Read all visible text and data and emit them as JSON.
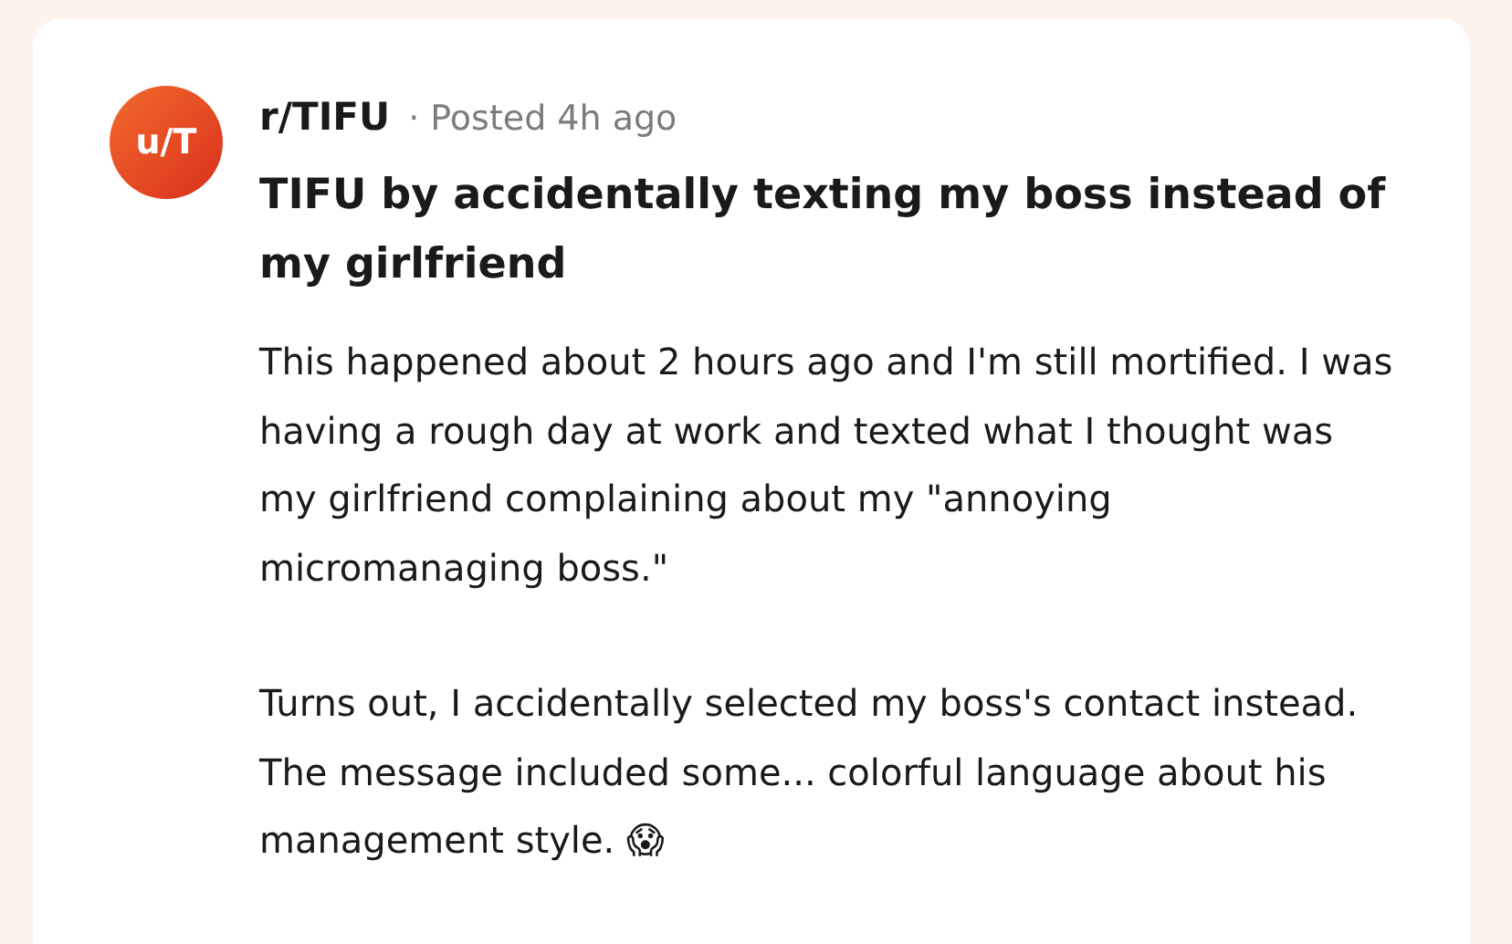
{
  "post": {
    "avatar": "u/T",
    "subreddit": "r/TIFU",
    "meta": "· Posted 4h ago",
    "title": "TIFU by accidentally texting my boss instead of my girlfriend",
    "body": [
      "This happened about 2 hours ago and I'm still mortified. I was having a rough day at work and texted what I thought was my girlfriend complaining about my \"annoying micromanaging boss.\"",
      "Turns out, I accidentally selected my boss's contact instead. The message included some... colorful language about his management style. 😱"
    ]
  }
}
